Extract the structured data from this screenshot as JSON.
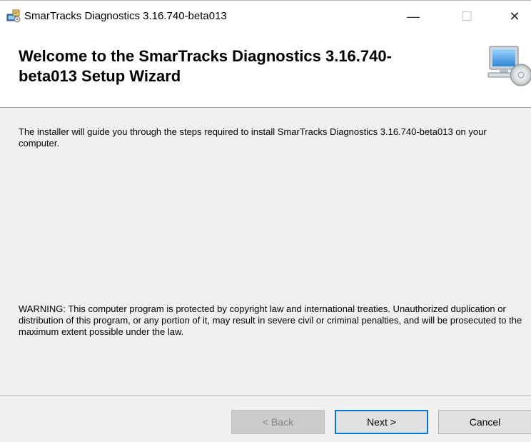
{
  "window": {
    "title": "SmarTracks Diagnostics 3.16.740-beta013",
    "minimize_glyph": "—",
    "maximize_glyph": "☐",
    "close_glyph": "✕"
  },
  "header": {
    "title": "Welcome to the SmarTracks Diagnostics 3.16.740-beta013 Setup Wizard",
    "icon": "computer-cd-icon"
  },
  "content": {
    "intro": "The installer will guide you through the steps required to install SmarTracks Diagnostics 3.16.740-beta013 on your computer.",
    "warning": "WARNING: This computer program is protected by copyright law and international treaties. Unauthorized duplication or distribution of this program, or any portion of it, may result in severe civil or criminal penalties, and will be prosecuted to the maximum extent possible under the law."
  },
  "buttons": {
    "back": "< Back",
    "next": "Next >",
    "cancel": "Cancel"
  },
  "colors": {
    "accent": "#0078d7",
    "background": "#f0f0f0"
  }
}
